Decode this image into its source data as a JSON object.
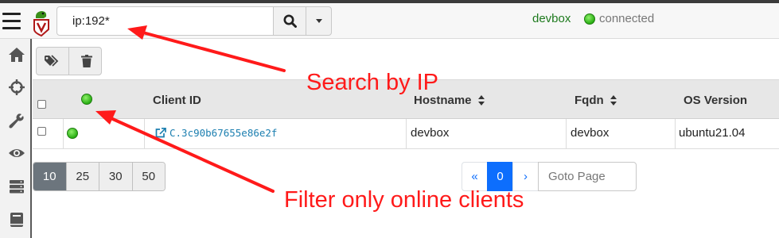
{
  "header": {
    "search": {
      "value": "ip:192*",
      "placeholder": ""
    },
    "user": "devbox",
    "connection_status": "connected",
    "connection_color": "#2aaf14"
  },
  "sidebar": {
    "items": [
      {
        "icon": "home-icon"
      },
      {
        "icon": "crosshairs-icon"
      },
      {
        "icon": "wrench-icon"
      },
      {
        "icon": "eye-icon"
      },
      {
        "icon": "server-icon"
      },
      {
        "icon": "book-icon"
      }
    ]
  },
  "toolbar": {
    "buttons": [
      {
        "icon": "tags-icon"
      },
      {
        "icon": "trash-icon"
      }
    ]
  },
  "table": {
    "columns": {
      "online": "",
      "client_id": "Client ID",
      "hostname": "Hostname",
      "fqdn": "Fqdn",
      "os_version": "OS Version"
    },
    "rows": [
      {
        "online": true,
        "client_id": "C.3c90b67655e86e2f",
        "hostname": "devbox",
        "fqdn": "devbox",
        "os_version": "ubuntu21.04"
      }
    ]
  },
  "pagination": {
    "page_sizes": [
      "10",
      "25",
      "30",
      "50"
    ],
    "active_page_size": "10",
    "prev": "«",
    "current_page": "0",
    "next": "›",
    "goto_placeholder": "Goto Page"
  },
  "annotations": {
    "search_callout": "Search by IP",
    "filter_callout": "Filter only online clients",
    "color": "#ff1a1a"
  }
}
